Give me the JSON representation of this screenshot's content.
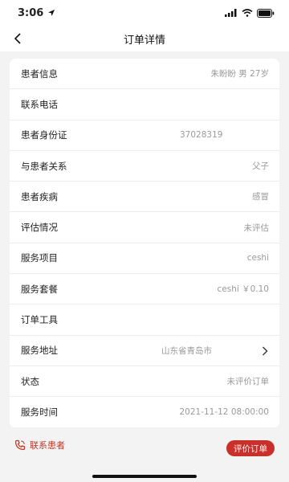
{
  "status_bar": {
    "time": "3:06"
  },
  "header": {
    "title": "订单详情"
  },
  "rows": [
    {
      "label": "患者信息",
      "value": "朱盼盼 男 27岁"
    },
    {
      "label": "联系电话",
      "value": ""
    },
    {
      "label": "患者身份证",
      "value": "37028319"
    },
    {
      "label": "与患者关系",
      "value": "父子"
    },
    {
      "label": "患者疾病",
      "value": "感冒"
    },
    {
      "label": "评估情况",
      "value": "未评估"
    },
    {
      "label": "服务项目",
      "value": "ceshi"
    },
    {
      "label": "服务套餐",
      "value": "ceshi ￥0.10"
    },
    {
      "label": "订单工具",
      "value": ""
    },
    {
      "label": "服务地址",
      "value": "山东省青岛市"
    },
    {
      "label": "状态",
      "value": "未评价订单"
    },
    {
      "label": "服务时间",
      "value": "2021-11-12 08:00:00"
    }
  ],
  "bottom": {
    "contact_label": "联系患者",
    "rate_button": "评价订单"
  },
  "colors": {
    "accent": "#c9302c",
    "background": "#f3f3f3",
    "card": "#ffffff"
  }
}
